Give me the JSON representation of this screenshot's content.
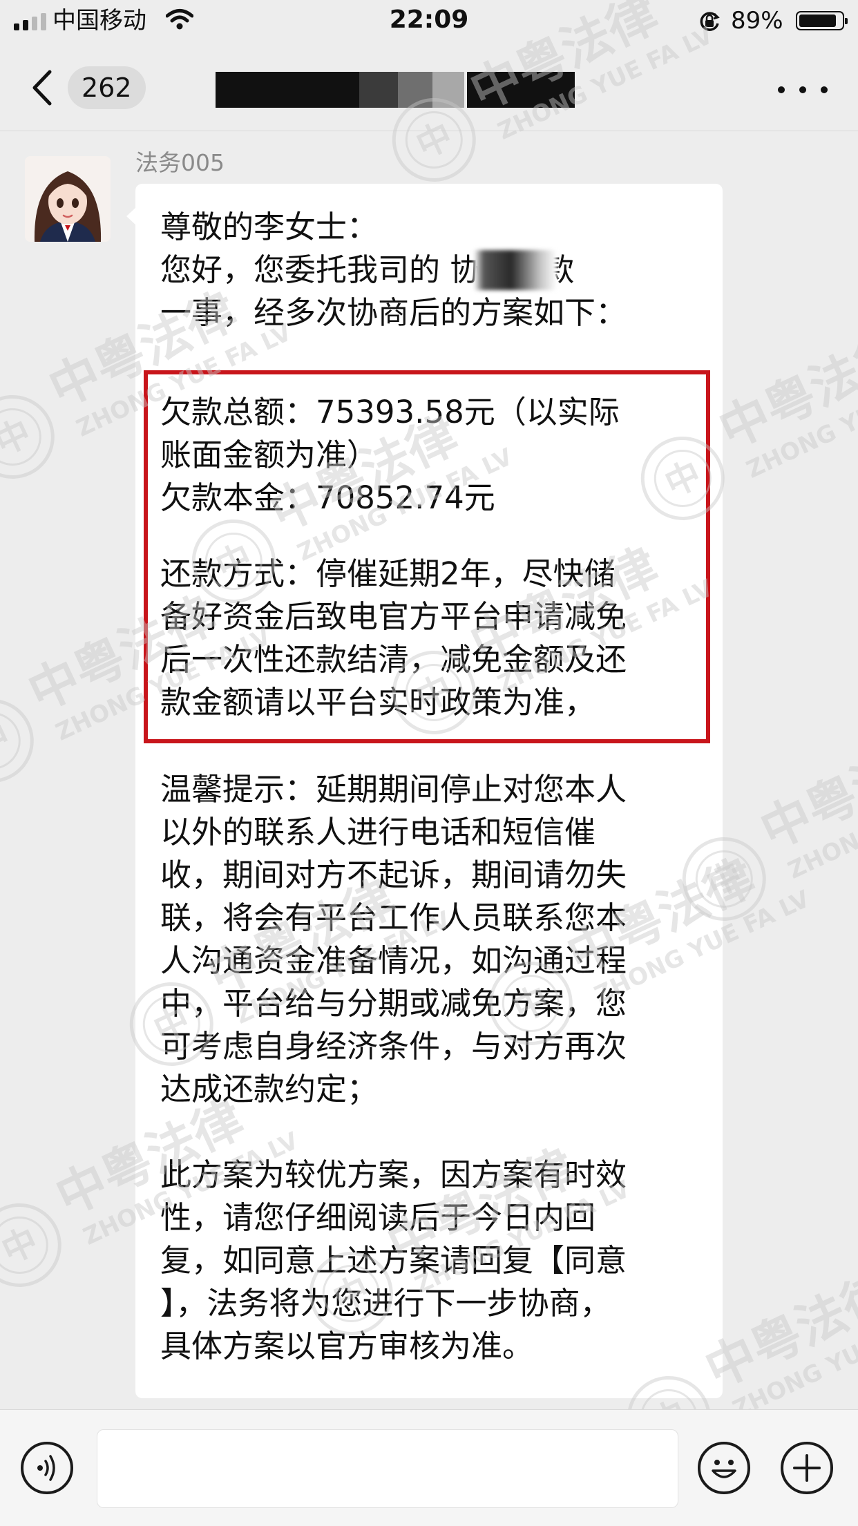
{
  "status_bar": {
    "carrier": "中国移动",
    "time": "22:09",
    "battery_percent": "89%",
    "battery_level": 0.89
  },
  "nav": {
    "unread_count": "262"
  },
  "chat": {
    "sender_name": "法务005",
    "message_lines": [
      "尊敬的李女士：",
      "您好，您委托我司的         协商还款",
      "一事，经多次协商后的方案如下：",
      "欠款总额：75393.58元（以实际",
      "账面金额为准）",
      "欠款本金：70852.74元",
      "还款方式：停催延期2年，尽快储",
      "备好资金后致电官方平台申请减免",
      "后一次性还款结清，减免金额及还",
      "款金额请以平台实时政策为准，",
      "温馨提示：延期期间停止对您本人",
      "以外的联系人进行电话和短信催",
      "收，期间对方不起诉，期间请勿失",
      "联，将会有平台工作人员联系您本",
      "人沟通资金准备情况，如沟通过程",
      "中，平台给与分期或减免方案，您",
      "可考虑自身经济条件，与对方再次",
      "达成还款约定；",
      "此方案为较优方案，因方案有时效",
      "性，请您仔细阅读后于今日内回",
      "复，如同意上述方案请回复【同意",
      "】，法务将为您进行下一步协商，",
      "具体方案以官方审核为准。"
    ]
  },
  "watermark": {
    "cn": "中粤法律",
    "en": "ZHONG YUE FA LV",
    "seal_char": "中",
    "color": "#c9c9c9"
  },
  "colors": {
    "background": "#ededed",
    "bubble": "#ffffff",
    "highlight_border": "#c8151b"
  },
  "icons": [
    "signal-icon",
    "wifi-icon",
    "orientation-lock-icon",
    "battery-icon",
    "back-chevron-icon",
    "more-icon",
    "voice-icon",
    "emoji-icon",
    "add-icon"
  ]
}
